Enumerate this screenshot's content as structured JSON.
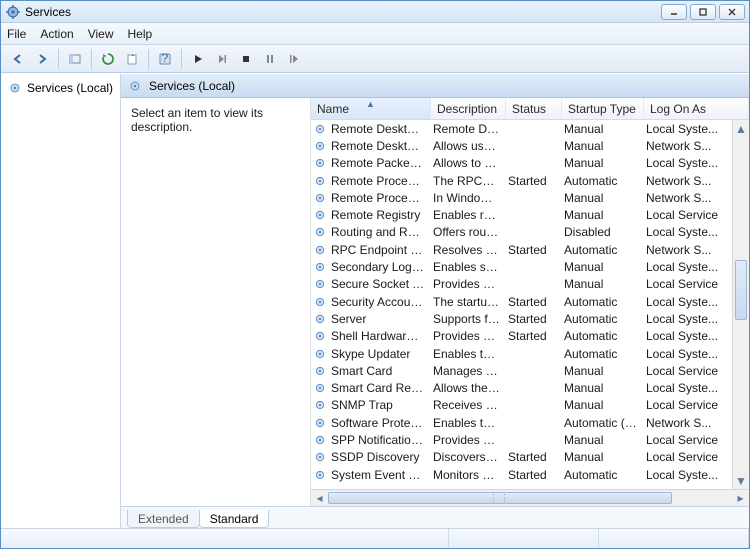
{
  "window": {
    "title": "Services"
  },
  "menu": {
    "file": "File",
    "action": "Action",
    "view": "View",
    "help": "Help"
  },
  "tree": {
    "root": "Services (Local)"
  },
  "content": {
    "header": "Services (Local)",
    "hint": "Select an item to view its description."
  },
  "columns": {
    "name": "Name",
    "description": "Description",
    "status": "Status",
    "startup": "Startup Type",
    "logon": "Log On As"
  },
  "tabs": {
    "extended": "Extended",
    "standard": "Standard"
  },
  "services": [
    {
      "name": "Remote Desktop ...",
      "desc": "Remote Des...",
      "status": "",
      "startup": "Manual",
      "logon": "Local Syste..."
    },
    {
      "name": "Remote Desktop S...",
      "desc": "Allows user...",
      "status": "",
      "startup": "Manual",
      "logon": "Network S..."
    },
    {
      "name": "Remote Packet Ca...",
      "desc": "Allows to ca...",
      "status": "",
      "startup": "Manual",
      "logon": "Local Syste..."
    },
    {
      "name": "Remote Procedur...",
      "desc": "The RPCSS ...",
      "status": "Started",
      "startup": "Automatic",
      "logon": "Network S..."
    },
    {
      "name": "Remote Procedur...",
      "desc": "In Windows...",
      "status": "",
      "startup": "Manual",
      "logon": "Network S..."
    },
    {
      "name": "Remote Registry",
      "desc": "Enables rem...",
      "status": "",
      "startup": "Manual",
      "logon": "Local Service"
    },
    {
      "name": "Routing and Rem...",
      "desc": "Offers routi...",
      "status": "",
      "startup": "Disabled",
      "logon": "Local Syste..."
    },
    {
      "name": "RPC Endpoint Ma...",
      "desc": "Resolves RP...",
      "status": "Started",
      "startup": "Automatic",
      "logon": "Network S..."
    },
    {
      "name": "Secondary Logon",
      "desc": "Enables star...",
      "status": "",
      "startup": "Manual",
      "logon": "Local Syste..."
    },
    {
      "name": "Secure Socket Tun...",
      "desc": "Provides su...",
      "status": "",
      "startup": "Manual",
      "logon": "Local Service"
    },
    {
      "name": "Security Accounts...",
      "desc": "The startup ...",
      "status": "Started",
      "startup": "Automatic",
      "logon": "Local Syste..."
    },
    {
      "name": "Server",
      "desc": "Supports fil...",
      "status": "Started",
      "startup": "Automatic",
      "logon": "Local Syste..."
    },
    {
      "name": "Shell Hardware De...",
      "desc": "Provides no...",
      "status": "Started",
      "startup": "Automatic",
      "logon": "Local Syste..."
    },
    {
      "name": "Skype Updater",
      "desc": "Enables the ...",
      "status": "",
      "startup": "Automatic",
      "logon": "Local Syste..."
    },
    {
      "name": "Smart Card",
      "desc": "Manages ac...",
      "status": "",
      "startup": "Manual",
      "logon": "Local Service"
    },
    {
      "name": "Smart Card Remo...",
      "desc": "Allows the s...",
      "status": "",
      "startup": "Manual",
      "logon": "Local Syste..."
    },
    {
      "name": "SNMP Trap",
      "desc": "Receives tra...",
      "status": "",
      "startup": "Manual",
      "logon": "Local Service"
    },
    {
      "name": "Software Protection",
      "desc": "Enables the ...",
      "status": "",
      "startup": "Automatic (D...",
      "logon": "Network S..."
    },
    {
      "name": "SPP Notification S...",
      "desc": "Provides So...",
      "status": "",
      "startup": "Manual",
      "logon": "Local Service"
    },
    {
      "name": "SSDP Discovery",
      "desc": "Discovers n...",
      "status": "Started",
      "startup": "Manual",
      "logon": "Local Service"
    },
    {
      "name": "System Event Noti...",
      "desc": "Monitors sy...",
      "status": "Started",
      "startup": "Automatic",
      "logon": "Local Syste..."
    }
  ]
}
